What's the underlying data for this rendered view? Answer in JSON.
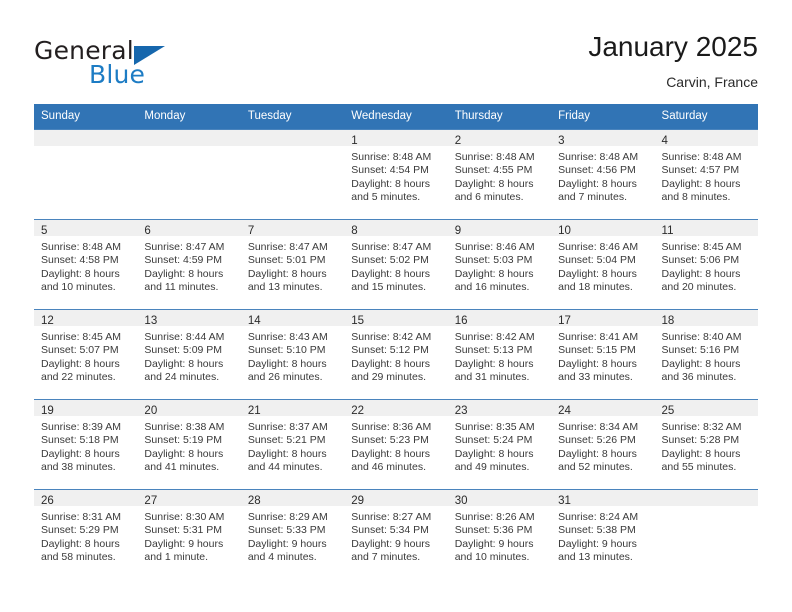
{
  "brand": {
    "name_top": "General",
    "name_bottom": "Blue",
    "triangle_icon": "triangle-icon",
    "color_blue": "#1d7cc4",
    "color_dark": "#231f20"
  },
  "header": {
    "title": "January 2025",
    "subtitle": "Carvin, France"
  },
  "theme": {
    "header_row_bg": "#3174b5",
    "header_row_text": "#ffffff",
    "daynum_bar_bg": "#f0f0f0",
    "grid_line": "#4a84bd",
    "body_text": "#3a3a3a"
  },
  "calendar": {
    "weekday_headers": [
      "Sunday",
      "Monday",
      "Tuesday",
      "Wednesday",
      "Thursday",
      "Friday",
      "Saturday"
    ],
    "weeks": [
      [
        {
          "day": "",
          "lines": []
        },
        {
          "day": "",
          "lines": []
        },
        {
          "day": "",
          "lines": []
        },
        {
          "day": "1",
          "lines": [
            "Sunrise: 8:48 AM",
            "Sunset: 4:54 PM",
            "Daylight: 8 hours",
            "and 5 minutes."
          ]
        },
        {
          "day": "2",
          "lines": [
            "Sunrise: 8:48 AM",
            "Sunset: 4:55 PM",
            "Daylight: 8 hours",
            "and 6 minutes."
          ]
        },
        {
          "day": "3",
          "lines": [
            "Sunrise: 8:48 AM",
            "Sunset: 4:56 PM",
            "Daylight: 8 hours",
            "and 7 minutes."
          ]
        },
        {
          "day": "4",
          "lines": [
            "Sunrise: 8:48 AM",
            "Sunset: 4:57 PM",
            "Daylight: 8 hours",
            "and 8 minutes."
          ]
        }
      ],
      [
        {
          "day": "5",
          "lines": [
            "Sunrise: 8:48 AM",
            "Sunset: 4:58 PM",
            "Daylight: 8 hours",
            "and 10 minutes."
          ]
        },
        {
          "day": "6",
          "lines": [
            "Sunrise: 8:47 AM",
            "Sunset: 4:59 PM",
            "Daylight: 8 hours",
            "and 11 minutes."
          ]
        },
        {
          "day": "7",
          "lines": [
            "Sunrise: 8:47 AM",
            "Sunset: 5:01 PM",
            "Daylight: 8 hours",
            "and 13 minutes."
          ]
        },
        {
          "day": "8",
          "lines": [
            "Sunrise: 8:47 AM",
            "Sunset: 5:02 PM",
            "Daylight: 8 hours",
            "and 15 minutes."
          ]
        },
        {
          "day": "9",
          "lines": [
            "Sunrise: 8:46 AM",
            "Sunset: 5:03 PM",
            "Daylight: 8 hours",
            "and 16 minutes."
          ]
        },
        {
          "day": "10",
          "lines": [
            "Sunrise: 8:46 AM",
            "Sunset: 5:04 PM",
            "Daylight: 8 hours",
            "and 18 minutes."
          ]
        },
        {
          "day": "11",
          "lines": [
            "Sunrise: 8:45 AM",
            "Sunset: 5:06 PM",
            "Daylight: 8 hours",
            "and 20 minutes."
          ]
        }
      ],
      [
        {
          "day": "12",
          "lines": [
            "Sunrise: 8:45 AM",
            "Sunset: 5:07 PM",
            "Daylight: 8 hours",
            "and 22 minutes."
          ]
        },
        {
          "day": "13",
          "lines": [
            "Sunrise: 8:44 AM",
            "Sunset: 5:09 PM",
            "Daylight: 8 hours",
            "and 24 minutes."
          ]
        },
        {
          "day": "14",
          "lines": [
            "Sunrise: 8:43 AM",
            "Sunset: 5:10 PM",
            "Daylight: 8 hours",
            "and 26 minutes."
          ]
        },
        {
          "day": "15",
          "lines": [
            "Sunrise: 8:42 AM",
            "Sunset: 5:12 PM",
            "Daylight: 8 hours",
            "and 29 minutes."
          ]
        },
        {
          "day": "16",
          "lines": [
            "Sunrise: 8:42 AM",
            "Sunset: 5:13 PM",
            "Daylight: 8 hours",
            "and 31 minutes."
          ]
        },
        {
          "day": "17",
          "lines": [
            "Sunrise: 8:41 AM",
            "Sunset: 5:15 PM",
            "Daylight: 8 hours",
            "and 33 minutes."
          ]
        },
        {
          "day": "18",
          "lines": [
            "Sunrise: 8:40 AM",
            "Sunset: 5:16 PM",
            "Daylight: 8 hours",
            "and 36 minutes."
          ]
        }
      ],
      [
        {
          "day": "19",
          "lines": [
            "Sunrise: 8:39 AM",
            "Sunset: 5:18 PM",
            "Daylight: 8 hours",
            "and 38 minutes."
          ]
        },
        {
          "day": "20",
          "lines": [
            "Sunrise: 8:38 AM",
            "Sunset: 5:19 PM",
            "Daylight: 8 hours",
            "and 41 minutes."
          ]
        },
        {
          "day": "21",
          "lines": [
            "Sunrise: 8:37 AM",
            "Sunset: 5:21 PM",
            "Daylight: 8 hours",
            "and 44 minutes."
          ]
        },
        {
          "day": "22",
          "lines": [
            "Sunrise: 8:36 AM",
            "Sunset: 5:23 PM",
            "Daylight: 8 hours",
            "and 46 minutes."
          ]
        },
        {
          "day": "23",
          "lines": [
            "Sunrise: 8:35 AM",
            "Sunset: 5:24 PM",
            "Daylight: 8 hours",
            "and 49 minutes."
          ]
        },
        {
          "day": "24",
          "lines": [
            "Sunrise: 8:34 AM",
            "Sunset: 5:26 PM",
            "Daylight: 8 hours",
            "and 52 minutes."
          ]
        },
        {
          "day": "25",
          "lines": [
            "Sunrise: 8:32 AM",
            "Sunset: 5:28 PM",
            "Daylight: 8 hours",
            "and 55 minutes."
          ]
        }
      ],
      [
        {
          "day": "26",
          "lines": [
            "Sunrise: 8:31 AM",
            "Sunset: 5:29 PM",
            "Daylight: 8 hours",
            "and 58 minutes."
          ]
        },
        {
          "day": "27",
          "lines": [
            "Sunrise: 8:30 AM",
            "Sunset: 5:31 PM",
            "Daylight: 9 hours",
            "and 1 minute."
          ]
        },
        {
          "day": "28",
          "lines": [
            "Sunrise: 8:29 AM",
            "Sunset: 5:33 PM",
            "Daylight: 9 hours",
            "and 4 minutes."
          ]
        },
        {
          "day": "29",
          "lines": [
            "Sunrise: 8:27 AM",
            "Sunset: 5:34 PM",
            "Daylight: 9 hours",
            "and 7 minutes."
          ]
        },
        {
          "day": "30",
          "lines": [
            "Sunrise: 8:26 AM",
            "Sunset: 5:36 PM",
            "Daylight: 9 hours",
            "and 10 minutes."
          ]
        },
        {
          "day": "31",
          "lines": [
            "Sunrise: 8:24 AM",
            "Sunset: 5:38 PM",
            "Daylight: 9 hours",
            "and 13 minutes."
          ]
        },
        {
          "day": "",
          "lines": []
        }
      ]
    ]
  }
}
